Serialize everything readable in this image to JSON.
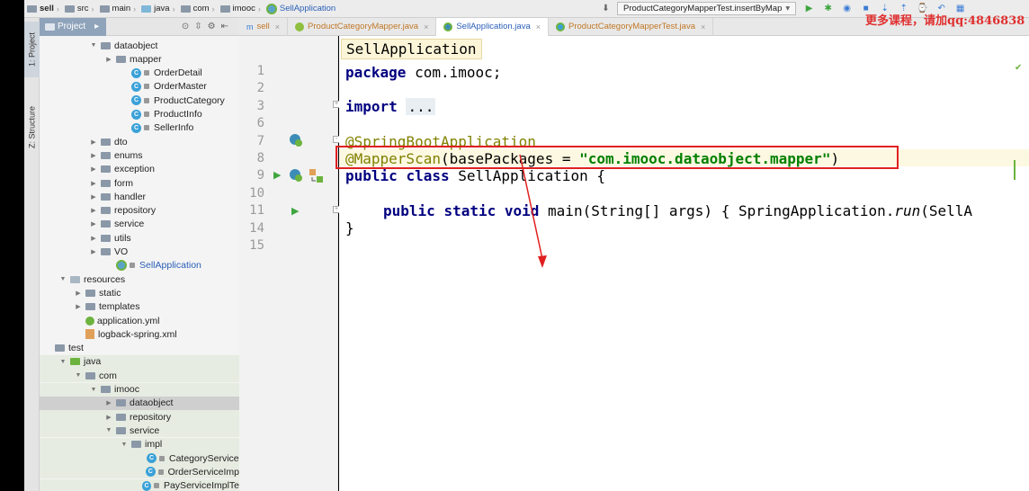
{
  "watermark": "更多课程，请加qq:4846838",
  "navbar": {
    "crumbs": [
      "sell",
      "src",
      "main",
      "java",
      "com",
      "imooc",
      "SellApplication"
    ],
    "run_config": "ProductCategoryMapperTest.insertByMap"
  },
  "tool_stripe": {
    "project": "1: Project",
    "structure": "Z: Structure"
  },
  "project_panel": {
    "title": "Project"
  },
  "tree": [
    {
      "label": "dataobject",
      "indent": 2,
      "kind": "folder",
      "arrow": "open"
    },
    {
      "label": "mapper",
      "indent": 3,
      "kind": "folder",
      "arrow": "closed"
    },
    {
      "label": "OrderDetail",
      "indent": 4,
      "kind": "class"
    },
    {
      "label": "OrderMaster",
      "indent": 4,
      "kind": "class"
    },
    {
      "label": "ProductCategory",
      "indent": 4,
      "kind": "class"
    },
    {
      "label": "ProductInfo",
      "indent": 4,
      "kind": "class"
    },
    {
      "label": "SellerInfo",
      "indent": 4,
      "kind": "class"
    },
    {
      "label": "dto",
      "indent": 2,
      "kind": "folder",
      "arrow": "closed"
    },
    {
      "label": "enums",
      "indent": 2,
      "kind": "folder",
      "arrow": "closed"
    },
    {
      "label": "exception",
      "indent": 2,
      "kind": "folder",
      "arrow": "closed"
    },
    {
      "label": "form",
      "indent": 2,
      "kind": "folder",
      "arrow": "closed"
    },
    {
      "label": "handler",
      "indent": 2,
      "kind": "folder",
      "arrow": "closed"
    },
    {
      "label": "repository",
      "indent": 2,
      "kind": "folder",
      "arrow": "closed"
    },
    {
      "label": "service",
      "indent": 2,
      "kind": "folder",
      "arrow": "closed"
    },
    {
      "label": "utils",
      "indent": 2,
      "kind": "folder",
      "arrow": "closed"
    },
    {
      "label": "VO",
      "indent": 2,
      "kind": "folder",
      "arrow": "closed"
    },
    {
      "label": "SellApplication",
      "indent": 3,
      "kind": "spring"
    },
    {
      "label": "resources",
      "indent": 0,
      "kind": "res",
      "arrow": "open"
    },
    {
      "label": "static",
      "indent": 1,
      "kind": "folder",
      "arrow": "closed"
    },
    {
      "label": "templates",
      "indent": 1,
      "kind": "folder",
      "arrow": "closed"
    },
    {
      "label": "application.yml",
      "indent": 1,
      "kind": "yml"
    },
    {
      "label": "logback-spring.xml",
      "indent": 1,
      "kind": "xml"
    },
    {
      "label": "test",
      "indent": -1,
      "kind": "folder"
    },
    {
      "label": "java",
      "indent": 0,
      "kind": "srcg",
      "arrow": "open",
      "hl": true
    },
    {
      "label": "com",
      "indent": 1,
      "kind": "folder",
      "arrow": "open",
      "hl": true
    },
    {
      "label": "imooc",
      "indent": 2,
      "kind": "folder",
      "arrow": "open",
      "hl": true
    },
    {
      "label": "dataobject",
      "indent": 3,
      "kind": "folder",
      "arrow": "closed",
      "sel": true
    },
    {
      "label": "repository",
      "indent": 3,
      "kind": "folder",
      "arrow": "closed",
      "hl": true
    },
    {
      "label": "service",
      "indent": 3,
      "kind": "folder",
      "arrow": "open",
      "hl": true
    },
    {
      "label": "impl",
      "indent": 4,
      "kind": "folder",
      "arrow": "open",
      "hl": true
    },
    {
      "label": "CategoryService",
      "indent": 5,
      "kind": "class",
      "hl": true
    },
    {
      "label": "OrderServiceImp",
      "indent": 5,
      "kind": "class",
      "hl": true
    },
    {
      "label": "PayServiceImplTe",
      "indent": 5,
      "kind": "class",
      "hl": true
    }
  ],
  "tabs": [
    {
      "label": "sell",
      "icon": "m"
    },
    {
      "label": "ProductCategoryMapper.java",
      "icon": "interface"
    },
    {
      "label": "SellApplication.java",
      "icon": "spring",
      "active": true
    },
    {
      "label": "ProductCategoryMapperTest.java",
      "icon": "class"
    }
  ],
  "editor": {
    "popup": "SellApplication",
    "line_numbers": [
      "1",
      "2",
      "3",
      "6",
      "7",
      "8",
      "9",
      "10",
      "11",
      "14",
      "15"
    ],
    "code": {
      "l1_kw": "package",
      "l1_rest": " com.imooc;",
      "l3_kw": "import",
      "l3_fold": "...",
      "l7": "@SpringBootApplication",
      "l8_anno": "@MapperScan",
      "l8_open": "(basePackages = ",
      "l8_str": "\"com.imooc.dataobject.mapper\"",
      "l8_close": ")",
      "l9_kw1": "public",
      "l9_kw2": "class",
      "l9_rest": " SellApplication {",
      "l11_kw1": "public",
      "l11_kw2": "static",
      "l11_kw3": "void",
      "l11_mid": " main(String[] args) ",
      "l11_fold": "{ SpringApplication.",
      "l11_it": "run",
      "l11_tail": "(SellA",
      "l14": "}"
    }
  }
}
